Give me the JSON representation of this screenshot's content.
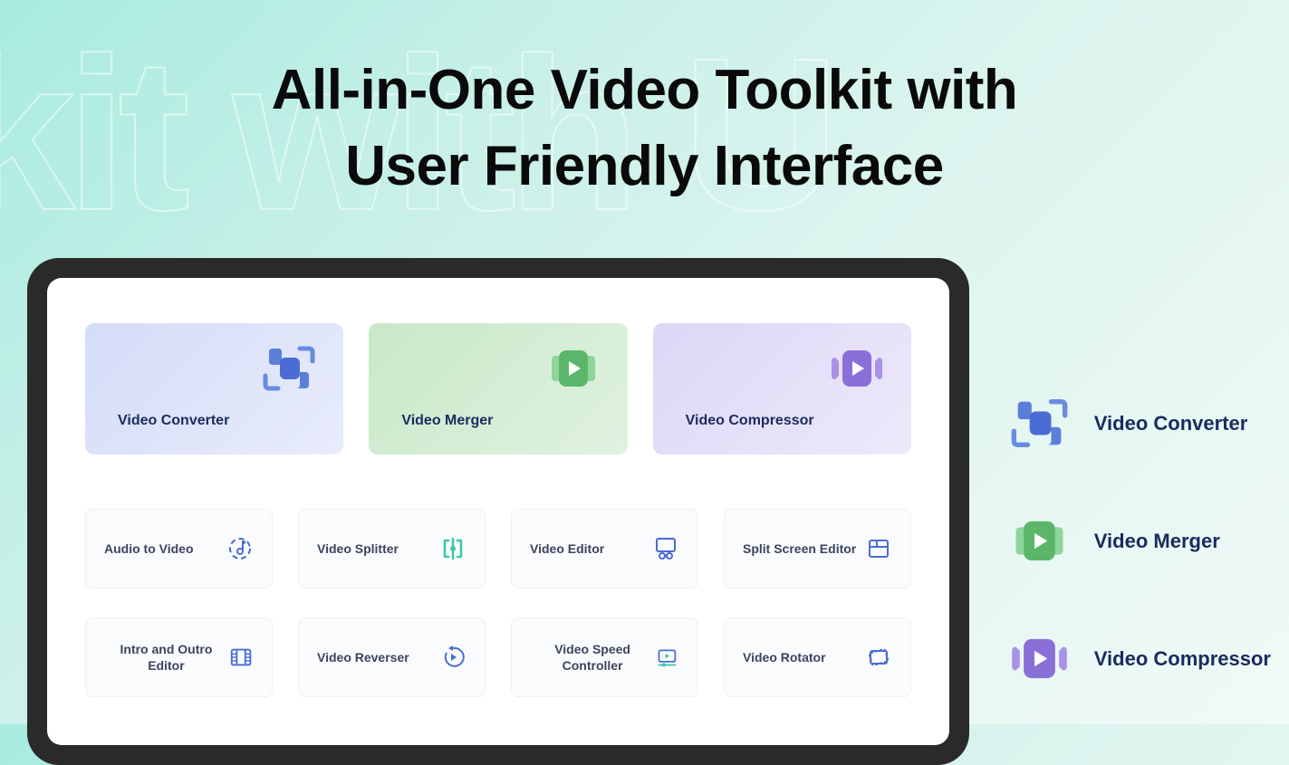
{
  "title_line1": "All-in-One Video Toolkit with",
  "title_line2": "User Friendly Interface",
  "bg_text": "kit with U",
  "main_cards": [
    {
      "label": "Video Converter",
      "icon": "converter",
      "color": "blue"
    },
    {
      "label": "Video Merger",
      "icon": "merger",
      "color": "green"
    },
    {
      "label": "Video Compressor",
      "icon": "compressor",
      "color": "purple"
    }
  ],
  "small_cards": [
    {
      "label": "Audio to Video",
      "icon": "audio-to-video"
    },
    {
      "label": "Video Splitter",
      "icon": "splitter"
    },
    {
      "label": "Video Editor",
      "icon": "editor"
    },
    {
      "label": "Split Screen Editor",
      "icon": "split-screen"
    },
    {
      "label": "Intro and Outro Editor",
      "icon": "intro-outro"
    },
    {
      "label": "Video Reverser",
      "icon": "reverser"
    },
    {
      "label": "Video Speed Controller",
      "icon": "speed"
    },
    {
      "label": "Video Rotator",
      "icon": "rotator"
    }
  ],
  "side_items": [
    {
      "label": "Video Converter",
      "icon": "converter"
    },
    {
      "label": "Video Merger",
      "icon": "merger"
    },
    {
      "label": "Video Compressor",
      "icon": "compressor"
    }
  ]
}
